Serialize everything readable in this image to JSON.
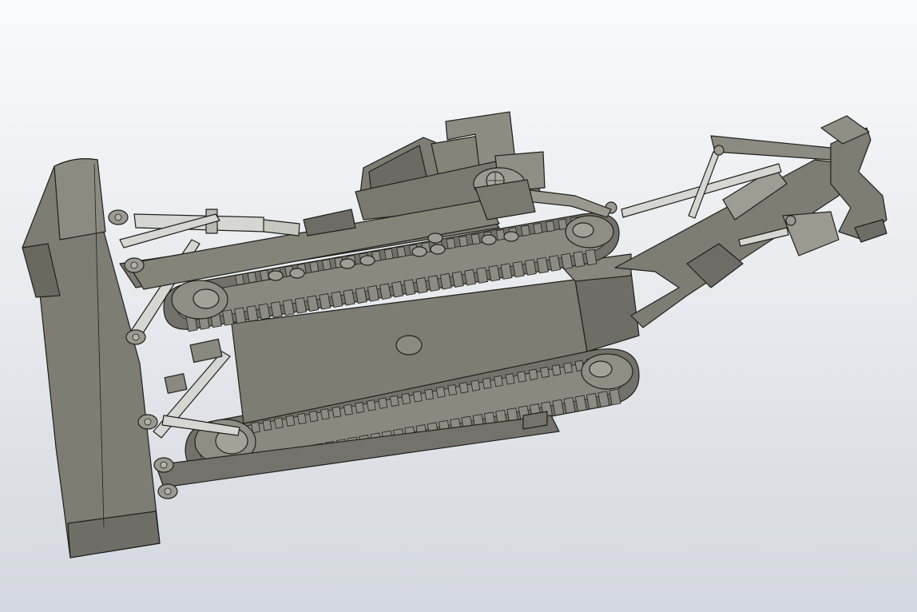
{
  "viewport": {
    "background_top": "#f9fafc",
    "background_bottom": "#d3d7df"
  },
  "model": {
    "body_color": "#7e7d74",
    "body_dark": "#66655d",
    "body_light": "#9b9a91",
    "edge_color": "#1f201c",
    "rod_color": "#d6d6d2",
    "parts": [
      "dozer-blade",
      "hull",
      "cab",
      "upper-track",
      "lower-track",
      "lift-cylinder",
      "push-arms",
      "ripper-frame",
      "ripper-shank",
      "ripper-cylinder"
    ]
  }
}
